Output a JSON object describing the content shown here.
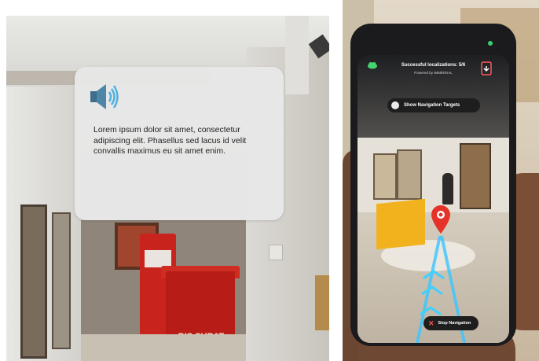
{
  "left_panel": {
    "info_card": {
      "icon": "speaker-icon",
      "text": "Lorem ipsum dolor sit amet, consectetur adipiscing elit. Phasellus sed lacus id velit convallis maximus eu sit amet enim."
    },
    "scene": {
      "mailbox_text": "BIS SURAT"
    }
  },
  "right_panel": {
    "phone": {
      "status_title": "Successful localizations: 5/6",
      "status_subtitle": "Powered by IMMERSAL",
      "cloud_icon": "cloud-icon",
      "exit_icon": "exit-icon",
      "show_navigation_targets_label": "Show Navigation Targets",
      "stop_navigation_label": "Stop Navigation",
      "navigation_pin_icon": "map-pin-icon",
      "accent_color": "#39c6ff",
      "pin_color": "#e5332a"
    }
  }
}
